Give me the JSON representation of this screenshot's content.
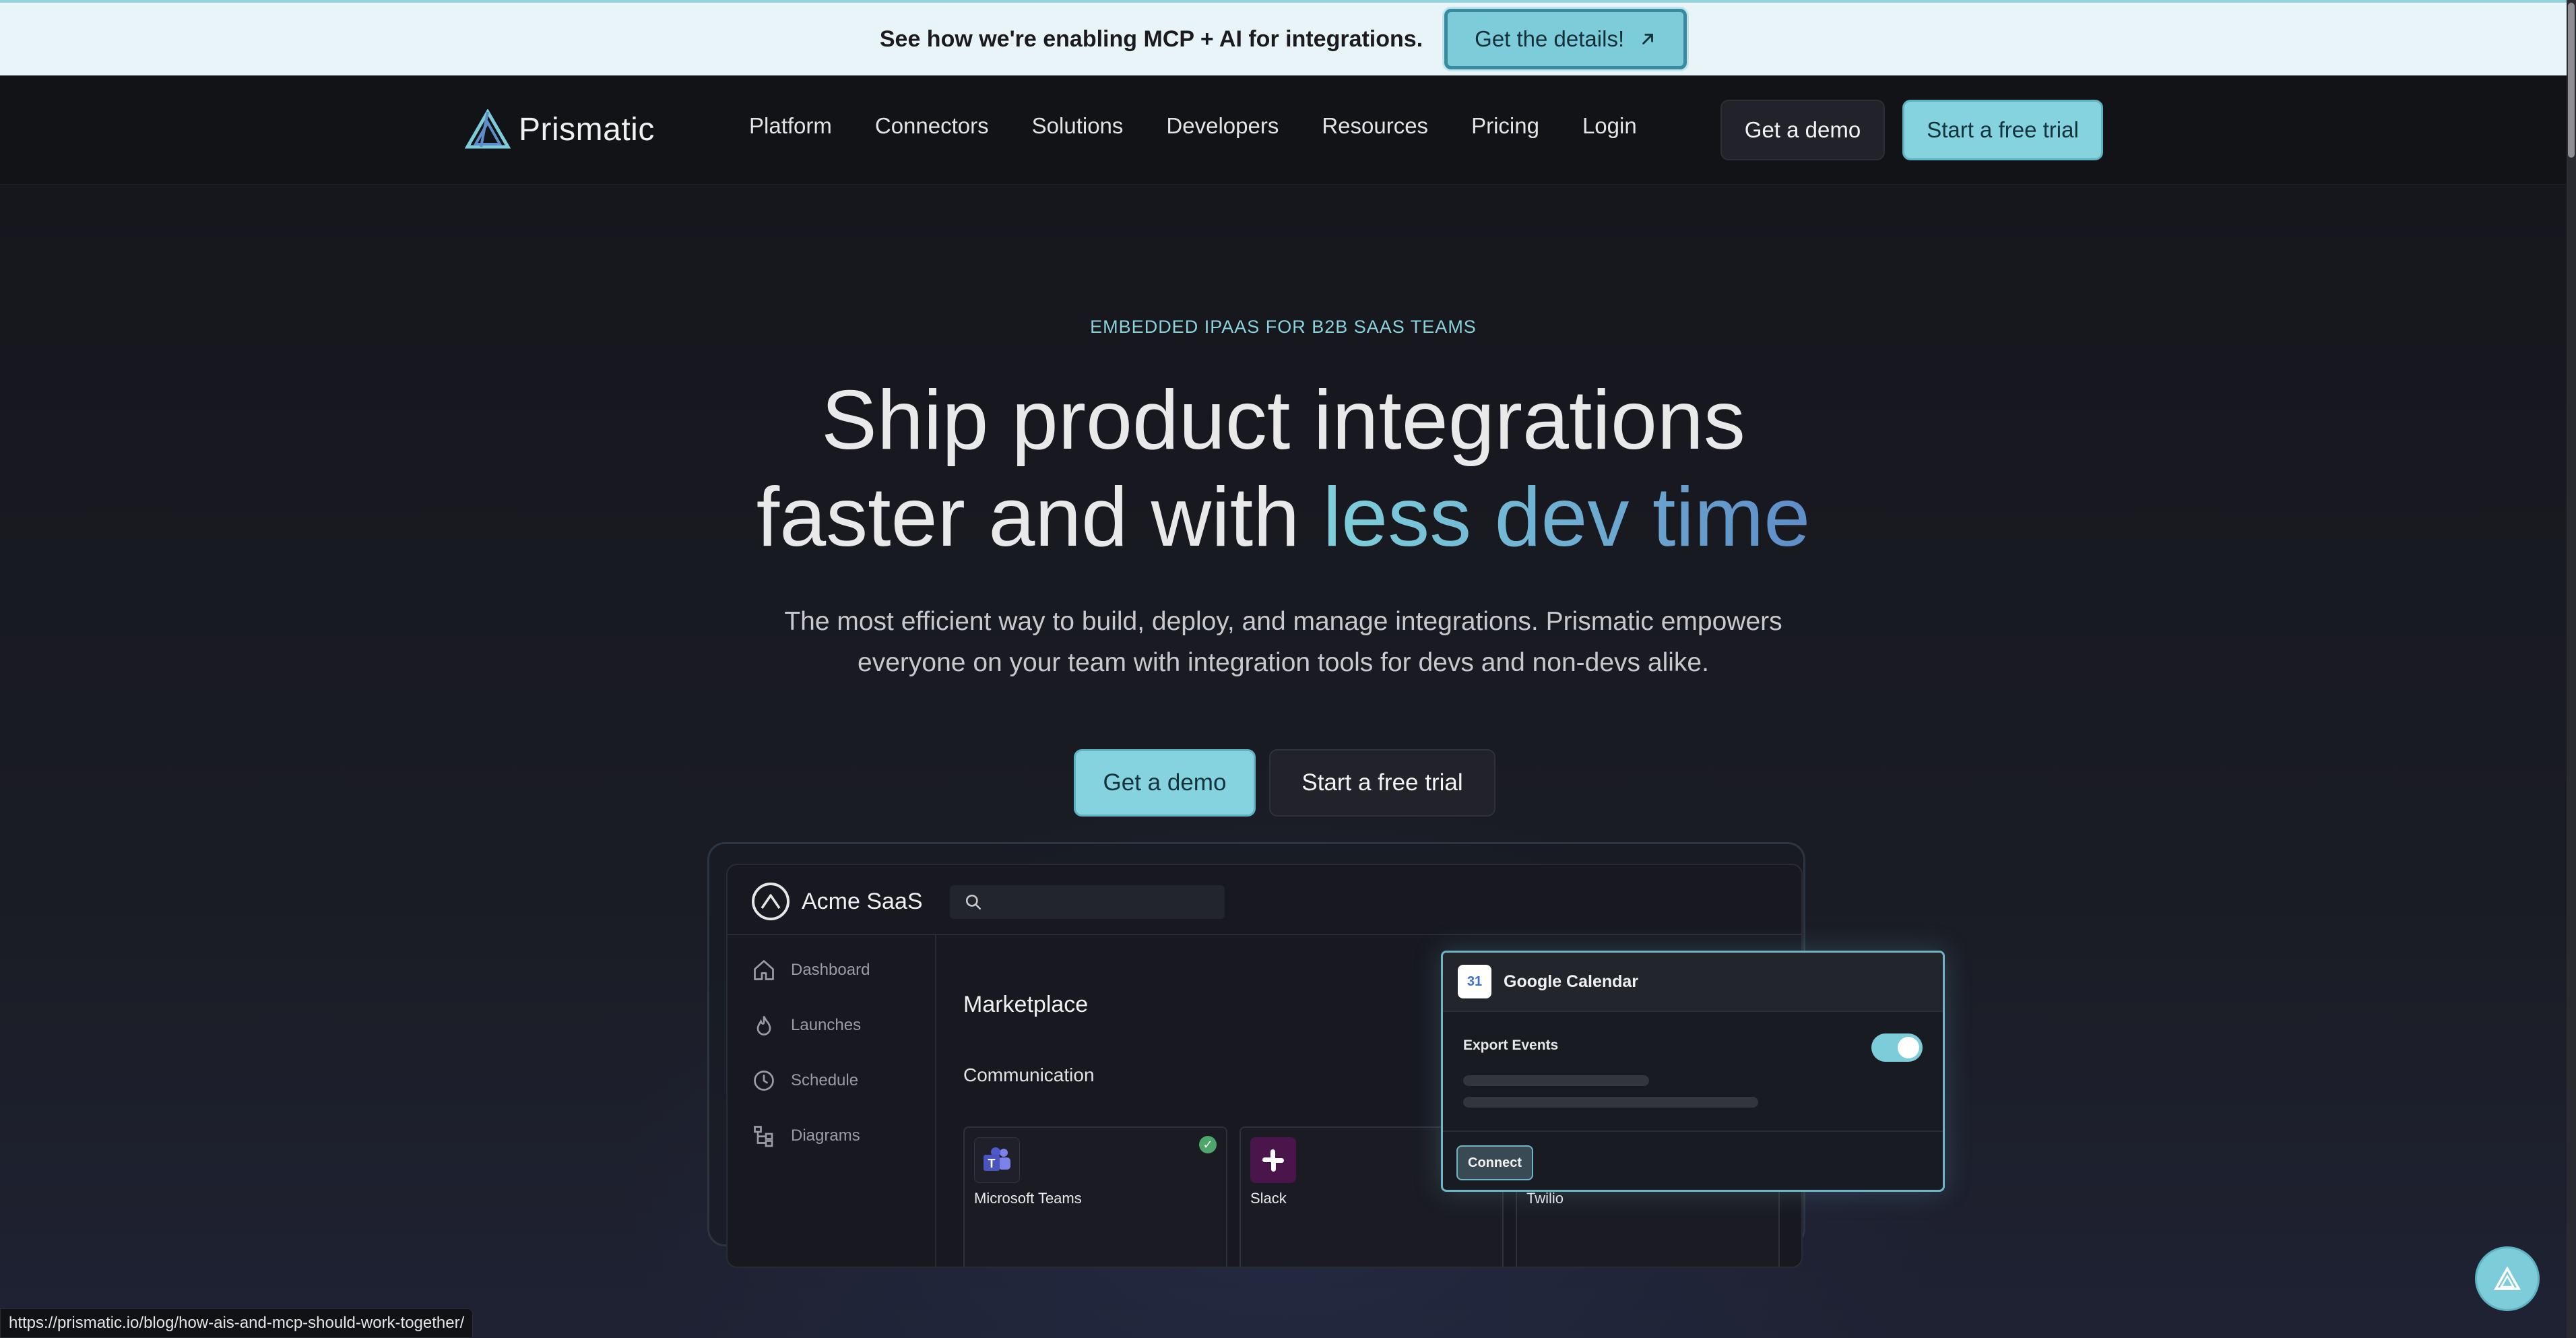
{
  "banner": {
    "text": "See how we're enabling MCP + AI for integrations.",
    "button_label": "Get the details!",
    "button_icon": "arrow-up-right-icon"
  },
  "nav": {
    "logo_text": "Prismatic",
    "links": [
      "Platform",
      "Connectors",
      "Solutions",
      "Developers",
      "Resources",
      "Pricing",
      "Login"
    ],
    "demo_label": "Get a demo",
    "trial_label": "Start a free trial"
  },
  "hero": {
    "eyebrow": "EMBEDDED IPAAS FOR B2B SAAS TEAMS",
    "headline_line1": "Ship product integrations",
    "headline_line2_plain": "faster and with ",
    "headline_line2_accent": "less dev time",
    "subhead": "The most efficient way to build, deploy, and manage integrations. Prismatic empowers everyone on your team with integration tools for devs and non-devs alike.",
    "cta_demo": "Get a demo",
    "cta_trial": "Start a free trial"
  },
  "mockup": {
    "app_name": "Acme SaaS",
    "sidebar": [
      "Dashboard",
      "Launches",
      "Schedule",
      "Diagrams"
    ],
    "main_title": "Marketplace",
    "section": "Communication",
    "cards": [
      {
        "name": "Microsoft Teams",
        "color": "#4b53bc",
        "checked": true
      },
      {
        "name": "Slack",
        "color": "#4a154b",
        "checked": false
      },
      {
        "name": "Twilio",
        "color": "#f22f46",
        "checked": true
      }
    ]
  },
  "popover": {
    "title": "Google Calendar",
    "calendar_icon_text": "31",
    "label": "Export Events",
    "toggle_on": true,
    "button_label": "Connect"
  },
  "status_url": "https://prismatic.io/blog/how-ais-and-mcp-should-work-together/",
  "colors": {
    "accent": "#85d3de",
    "accent_gradient_end": "#5f8dc8",
    "background": "#15161c"
  }
}
